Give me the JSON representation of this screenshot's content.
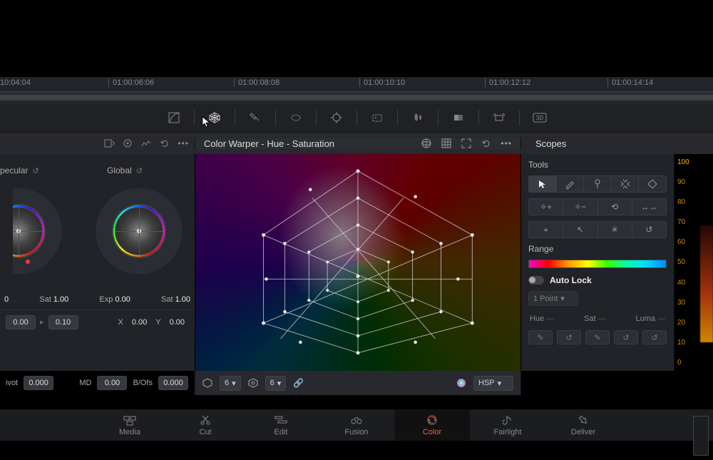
{
  "timeline": {
    "ticks": [
      "10:04:04",
      "01:00:06:06",
      "01:00:08:08",
      "01:00:10:10",
      "01:00:12:12",
      "01:00:14:14"
    ],
    "tick_positions": [
      0,
      152,
      328,
      504,
      680,
      852
    ]
  },
  "toolbar_icons": [
    "curves",
    "warper",
    "qualifier",
    "window",
    "tracker",
    "magic-mask",
    "blur",
    "key",
    "sizing",
    "3d"
  ],
  "left_header_icons": [
    "collapse",
    "target",
    "graph",
    "reset",
    "more"
  ],
  "panel_title": "Color Warper - Hue - Saturation",
  "panel_header_icons": [
    "orb",
    "grid",
    "expand",
    "reset",
    "more"
  ],
  "scopes_label": "Scopes",
  "wheels": {
    "labels": [
      "pecular",
      "Global"
    ],
    "specular": {
      "param1_label": "",
      "param1_val": "0",
      "sat_label": "Sat",
      "sat_val": "1.00"
    },
    "global": {
      "exp_label": "Exp",
      "exp_val": "0.00",
      "sat_label": "Sat",
      "sat_val": "1.00"
    },
    "xy": {
      "xl": "X",
      "xv": "0.00",
      "yl": "Y",
      "yv": "0.00"
    },
    "lrow": {
      "v1": "0.00",
      "v2": "0.10"
    },
    "bottom": {
      "ivot_label": "ivot",
      "ivot_val": "0.000",
      "md_label": "MD",
      "md_val": "0.00",
      "bofs_label": "B/Ofs",
      "bofs_val": "0.000"
    }
  },
  "warper": {
    "res1": "6",
    "res2": "6",
    "mode_label": "HSP"
  },
  "tools": {
    "title": "Tools",
    "row1": [
      "select",
      "draw",
      "pin",
      "contract",
      "stretch"
    ],
    "row2": [
      "add-point",
      "remove-point",
      "rotate",
      "expand-arrows"
    ],
    "row3": [
      "show-points",
      "move-all",
      "center",
      "reset-circle"
    ],
    "range_label": "Range",
    "autolock_label": "Auto Lock",
    "point_select": "1 Point",
    "hue_label": "Hue",
    "sat_label": "Sat",
    "luma_label": "Luma"
  },
  "scopes": {
    "scale": [
      "100",
      "90",
      "80",
      "70",
      "60",
      "50",
      "40",
      "30",
      "20",
      "10",
      "0"
    ]
  },
  "page_tabs": [
    {
      "id": "media",
      "label": "Media"
    },
    {
      "id": "cut",
      "label": "Cut"
    },
    {
      "id": "edit",
      "label": "Edit"
    },
    {
      "id": "fusion",
      "label": "Fusion"
    },
    {
      "id": "color",
      "label": "Color"
    },
    {
      "id": "fairlight",
      "label": "Fairlight"
    },
    {
      "id": "deliver",
      "label": "Deliver"
    }
  ],
  "active_tab": "color"
}
